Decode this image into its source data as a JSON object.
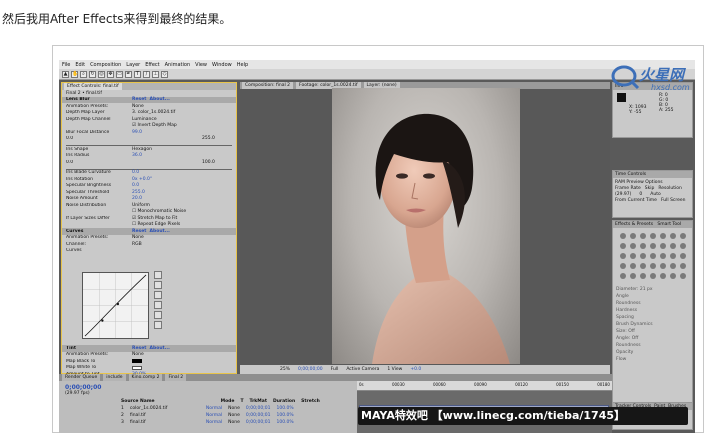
{
  "caption": "然后我用After Effects来得到最终的结果。",
  "menu": [
    "File",
    "Edit",
    "Composition",
    "Layer",
    "Effect",
    "Animation",
    "View",
    "Window",
    "Help"
  ],
  "effect_controls": {
    "tab_label": "Effect Controls: final.tif",
    "layer_label": "Final 2 • final.tif",
    "lens_blur": {
      "title": "Lens Blur",
      "reset": "Reset",
      "about": "About...",
      "preset_label": "Animation Presets:",
      "preset_value": "None",
      "depth_map_layer_label": "Depth Map Layer",
      "depth_map_layer_value": "3. color_1s.0024.tif",
      "depth_map_channel_label": "Depth Map Channel",
      "depth_map_channel_value": "Luminance",
      "invert_label": "Invert Depth Map",
      "blur_focal_label": "Blur Focal Distance",
      "blur_focal_value": "99.0",
      "range_min": "0.0",
      "range_max": "255.0",
      "iris_shape_label": "Iris Shape",
      "iris_shape_value": "Hexagon",
      "iris_radius_label": "Iris Radius",
      "iris_radius_value": "36.0",
      "radius_min": "0.0",
      "radius_max": "100.0",
      "iris_blade_label": "Iris Blade Curvature",
      "iris_blade_value": "0.0",
      "iris_rotation_label": "Iris Rotation",
      "iris_rotation_value": "0x +0.0°",
      "specular_brightness_label": "Specular Brightness",
      "specular_brightness_value": "0.0",
      "specular_threshold_label": "Specular Threshold",
      "specular_threshold_value": "255.0",
      "noise_amount_label": "Noise Amount",
      "noise_amount_value": "20.0",
      "noise_distribution_label": "Noise Distribution",
      "noise_distribution_value": "Uniform",
      "mono_noise_label": "Monochromatic Noise",
      "layer_size_label": "If Layer Sizes Differ",
      "stretch_label": "Stretch Map to Fit",
      "repeat_edge_label": "Repeat Edge Pixels"
    },
    "curves": {
      "title": "Curves",
      "reset": "Reset",
      "about": "About...",
      "preset_label": "Animation Presets:",
      "preset_value": "None",
      "channel_label": "Channel:",
      "channel_value": "RGB",
      "curves_label": "Curves"
    },
    "tint": {
      "title": "Tint",
      "reset": "Reset",
      "about": "About...",
      "preset_label": "Animation Presets:",
      "preset_value": "None",
      "map_black_label": "Map Black To",
      "map_white_label": "Map White To",
      "amount_label": "Amount to Tint",
      "amount_value": "30.0%"
    }
  },
  "composition": {
    "tabs": [
      "Composition: final 2",
      "Footage: color_1s.0024.tif",
      "Layer: (none)"
    ],
    "bottom": {
      "zoom": "25%",
      "timecode": "0;00;00;00",
      "resolution": "Full",
      "camera": "Active Camera",
      "views": "1 View",
      "exposure": "+0.0"
    },
    "colors": {
      "hair": "#1b1513",
      "skin": "#e4b8a4",
      "lips": "#b8706c"
    }
  },
  "info_panel": {
    "title": "Info",
    "values": [
      "R: 0",
      "G: 0",
      "B: 0",
      "A: 255"
    ],
    "x": "X: 1093",
    "y": "Y: -55"
  },
  "time_controls": {
    "title": "Time Controls",
    "preview_label": "RAM Preview Options",
    "frame_rate_label": "Frame Rate",
    "skip_label": "Skip",
    "resolution_label": "Resolution",
    "frame_rate_value": "(29.97)",
    "skip_value": "0",
    "resolution_value": "Auto",
    "from_current": "From Current Time",
    "full_screen": "Full Screen"
  },
  "effects_presets": {
    "tabs": [
      "Effects & Presets",
      "Smart Tool"
    ]
  },
  "paint_panel": {
    "labels": [
      "Diameter",
      "Angle",
      "Roundness",
      "Hardness",
      "Spacing",
      "Brush Dynamics",
      "Size",
      "Angle",
      "Roundness",
      "Opacity",
      "Flow"
    ],
    "diameter_value": "21 px",
    "size_value": "Off",
    "angle_value": "Off"
  },
  "timeline": {
    "tabs": [
      "Render Queue",
      "include",
      "Kino.comp 2",
      "Final 2"
    ],
    "timecode": "0;00;00;00",
    "fps": "(29.97 fps)",
    "col_headers": [
      "Source Name",
      "Mode",
      "T",
      "TrkMat",
      "Duration",
      "Stretch"
    ],
    "layers": [
      {
        "num": "1",
        "name": "color_1s.0024.tif",
        "mode": "Normal",
        "trkmat": "None",
        "duration": "0;00;00;01",
        "stretch": "100.0%"
      },
      {
        "num": "2",
        "name": "final.tif",
        "mode": "Normal",
        "trkmat": "None",
        "duration": "0;00;00;01",
        "stretch": "100.0%"
      },
      {
        "num": "3",
        "name": "final.tif",
        "mode": "Normal",
        "trkmat": "None",
        "duration": "0;00;00;01",
        "stretch": "100.0%"
      }
    ],
    "ruler_labels": [
      "0s",
      "00030",
      "00060",
      "00090",
      "00120",
      "00150",
      "00180"
    ]
  },
  "right_bottom_panels": {
    "tabs": [
      "Tracker Controls",
      "Paint",
      "Brushes"
    ]
  },
  "logo": {
    "main": "火星网",
    "sub": "hxsd.com"
  },
  "watermark": "MAYA特效吧  【www.linecg.com/tieba/1745】"
}
